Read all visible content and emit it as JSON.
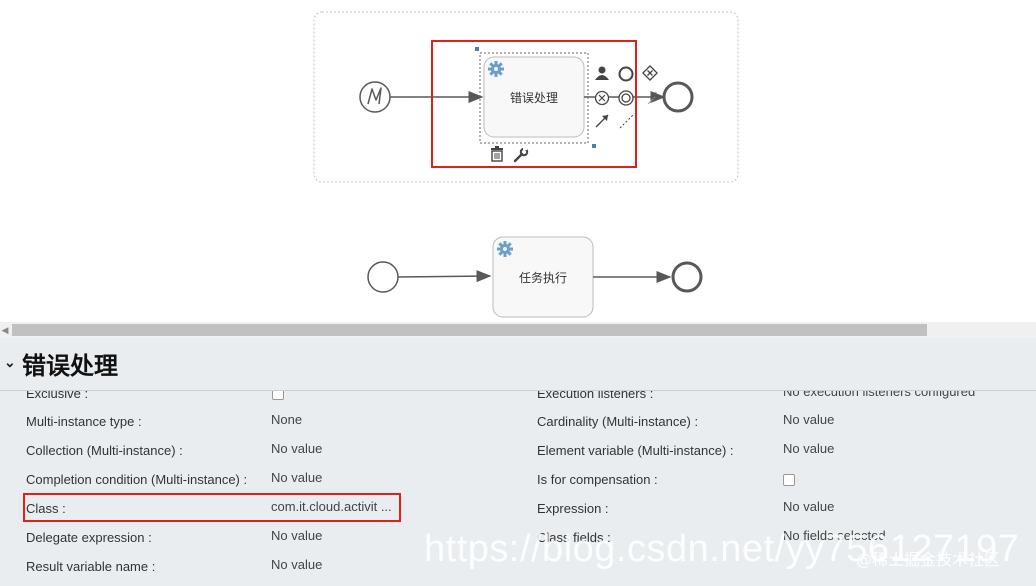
{
  "diagram": {
    "selected_task": "错误处理",
    "second_task": "任务执行"
  },
  "properties": {
    "title": "错误处理",
    "left": [
      {
        "label": "Exclusive :",
        "value": "",
        "checkbox": true
      },
      {
        "label": "Multi-instance type :",
        "value": "None"
      },
      {
        "label": "Collection (Multi-instance) :",
        "value": "No value"
      },
      {
        "label": "Completion condition (Multi-instance) :",
        "value": "No value"
      },
      {
        "label": "Class :",
        "value": "com.it.cloud.activit ..."
      },
      {
        "label": "Delegate expression :",
        "value": "No value"
      },
      {
        "label": "Result variable name :",
        "value": "No value"
      }
    ],
    "right": [
      {
        "label": "Execution listeners :",
        "value": "No execution listeners configured"
      },
      {
        "label": "Cardinality (Multi-instance) :",
        "value": "No value"
      },
      {
        "label": "Element variable (Multi-instance) :",
        "value": "No value"
      },
      {
        "label": "Is for compensation :",
        "value": "",
        "checkbox": true
      },
      {
        "label": "Expression :",
        "value": "No value"
      },
      {
        "label": "Class fields :",
        "value": "No fields selected"
      }
    ]
  },
  "watermark": {
    "url": "https://blog.csdn.net/yy756127197",
    "tag": "@稀土掘金技术社区"
  },
  "colors": {
    "highlight": "#e0201c",
    "panel_bg": "#e9edf0",
    "task_icon": "#6a9ecb"
  }
}
